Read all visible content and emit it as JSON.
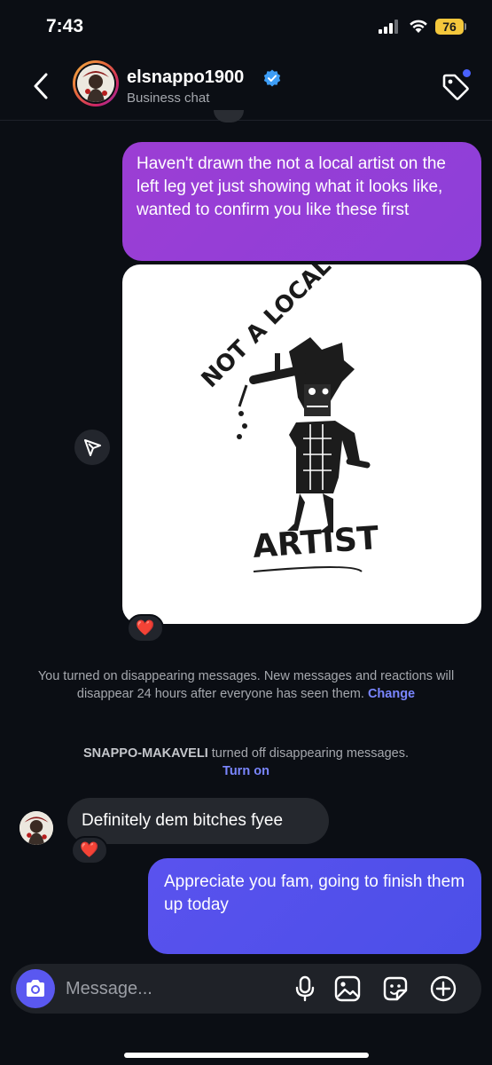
{
  "status_bar": {
    "time": "7:43",
    "battery": "76"
  },
  "header": {
    "name": "elsnappo1900",
    "subtitle": "Business chat"
  },
  "messages": {
    "outgoing_1": "Haven't drawn the not a local artist on the left leg yet just showing what it looks like, wanted to confirm you like these first",
    "image_text_top": "NOT A LOCAL",
    "image_text_bottom": "ARTIST",
    "reaction_1": "❤️",
    "system_1_text": "You turned on disappearing messages. New messages and reactions will disappear 24 hours after everyone has seen them.",
    "system_1_link": "Change",
    "system_2_user": "SNAPPO-MAKAVELI",
    "system_2_text": "turned off disappearing messages.",
    "system_2_link": "Turn on",
    "incoming_1": "Definitely dem bitches fyee",
    "reaction_2": "❤️",
    "outgoing_2": "Appreciate you fam, going to finish them up today"
  },
  "composer": {
    "placeholder": "Message..."
  },
  "colors": {
    "background": "#0b0e14",
    "outgoing_purple": "#9c3ed4",
    "outgoing_blue": "#5a52ee",
    "incoming": "#25282e",
    "link": "#7a86ff",
    "battery": "#f4c73c"
  },
  "icons": [
    "back-icon",
    "verified-badge-icon",
    "tag-icon",
    "share-icon",
    "camera-icon",
    "microphone-icon",
    "gallery-icon",
    "sticker-icon",
    "add-icon"
  ]
}
